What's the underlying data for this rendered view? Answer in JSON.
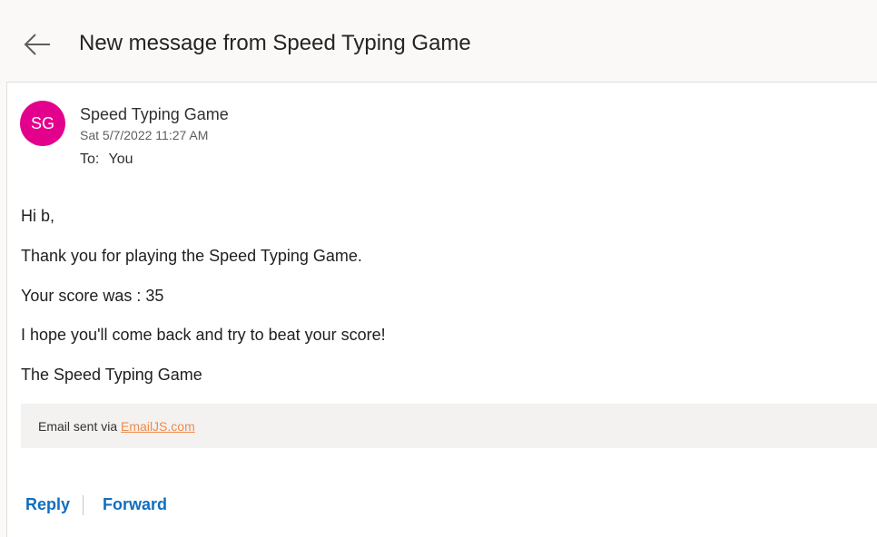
{
  "header": {
    "back_icon": "arrow-left-icon",
    "title": "New message from Speed Typing Game"
  },
  "message": {
    "avatar_initials": "SG",
    "avatar_color": "#e3008c",
    "sender": "Speed Typing Game",
    "date": "Sat 5/7/2022 11:27 AM",
    "to_label": "To:",
    "to_value": "You",
    "body": {
      "greeting": "Hi b,",
      "thanks": "Thank you for playing the Speed Typing Game.",
      "score": "Your score was : 35",
      "hope": "I hope you'll come back and try to beat your score!",
      "signature": "The Speed Typing Game"
    },
    "footer": {
      "prefix": "Email sent via",
      "link_text": "EmailJS.com",
      "link_color": "#f08a4b"
    }
  },
  "actions": {
    "reply_label": "Reply",
    "forward_label": "Forward",
    "accent_color": "#106ebe"
  }
}
